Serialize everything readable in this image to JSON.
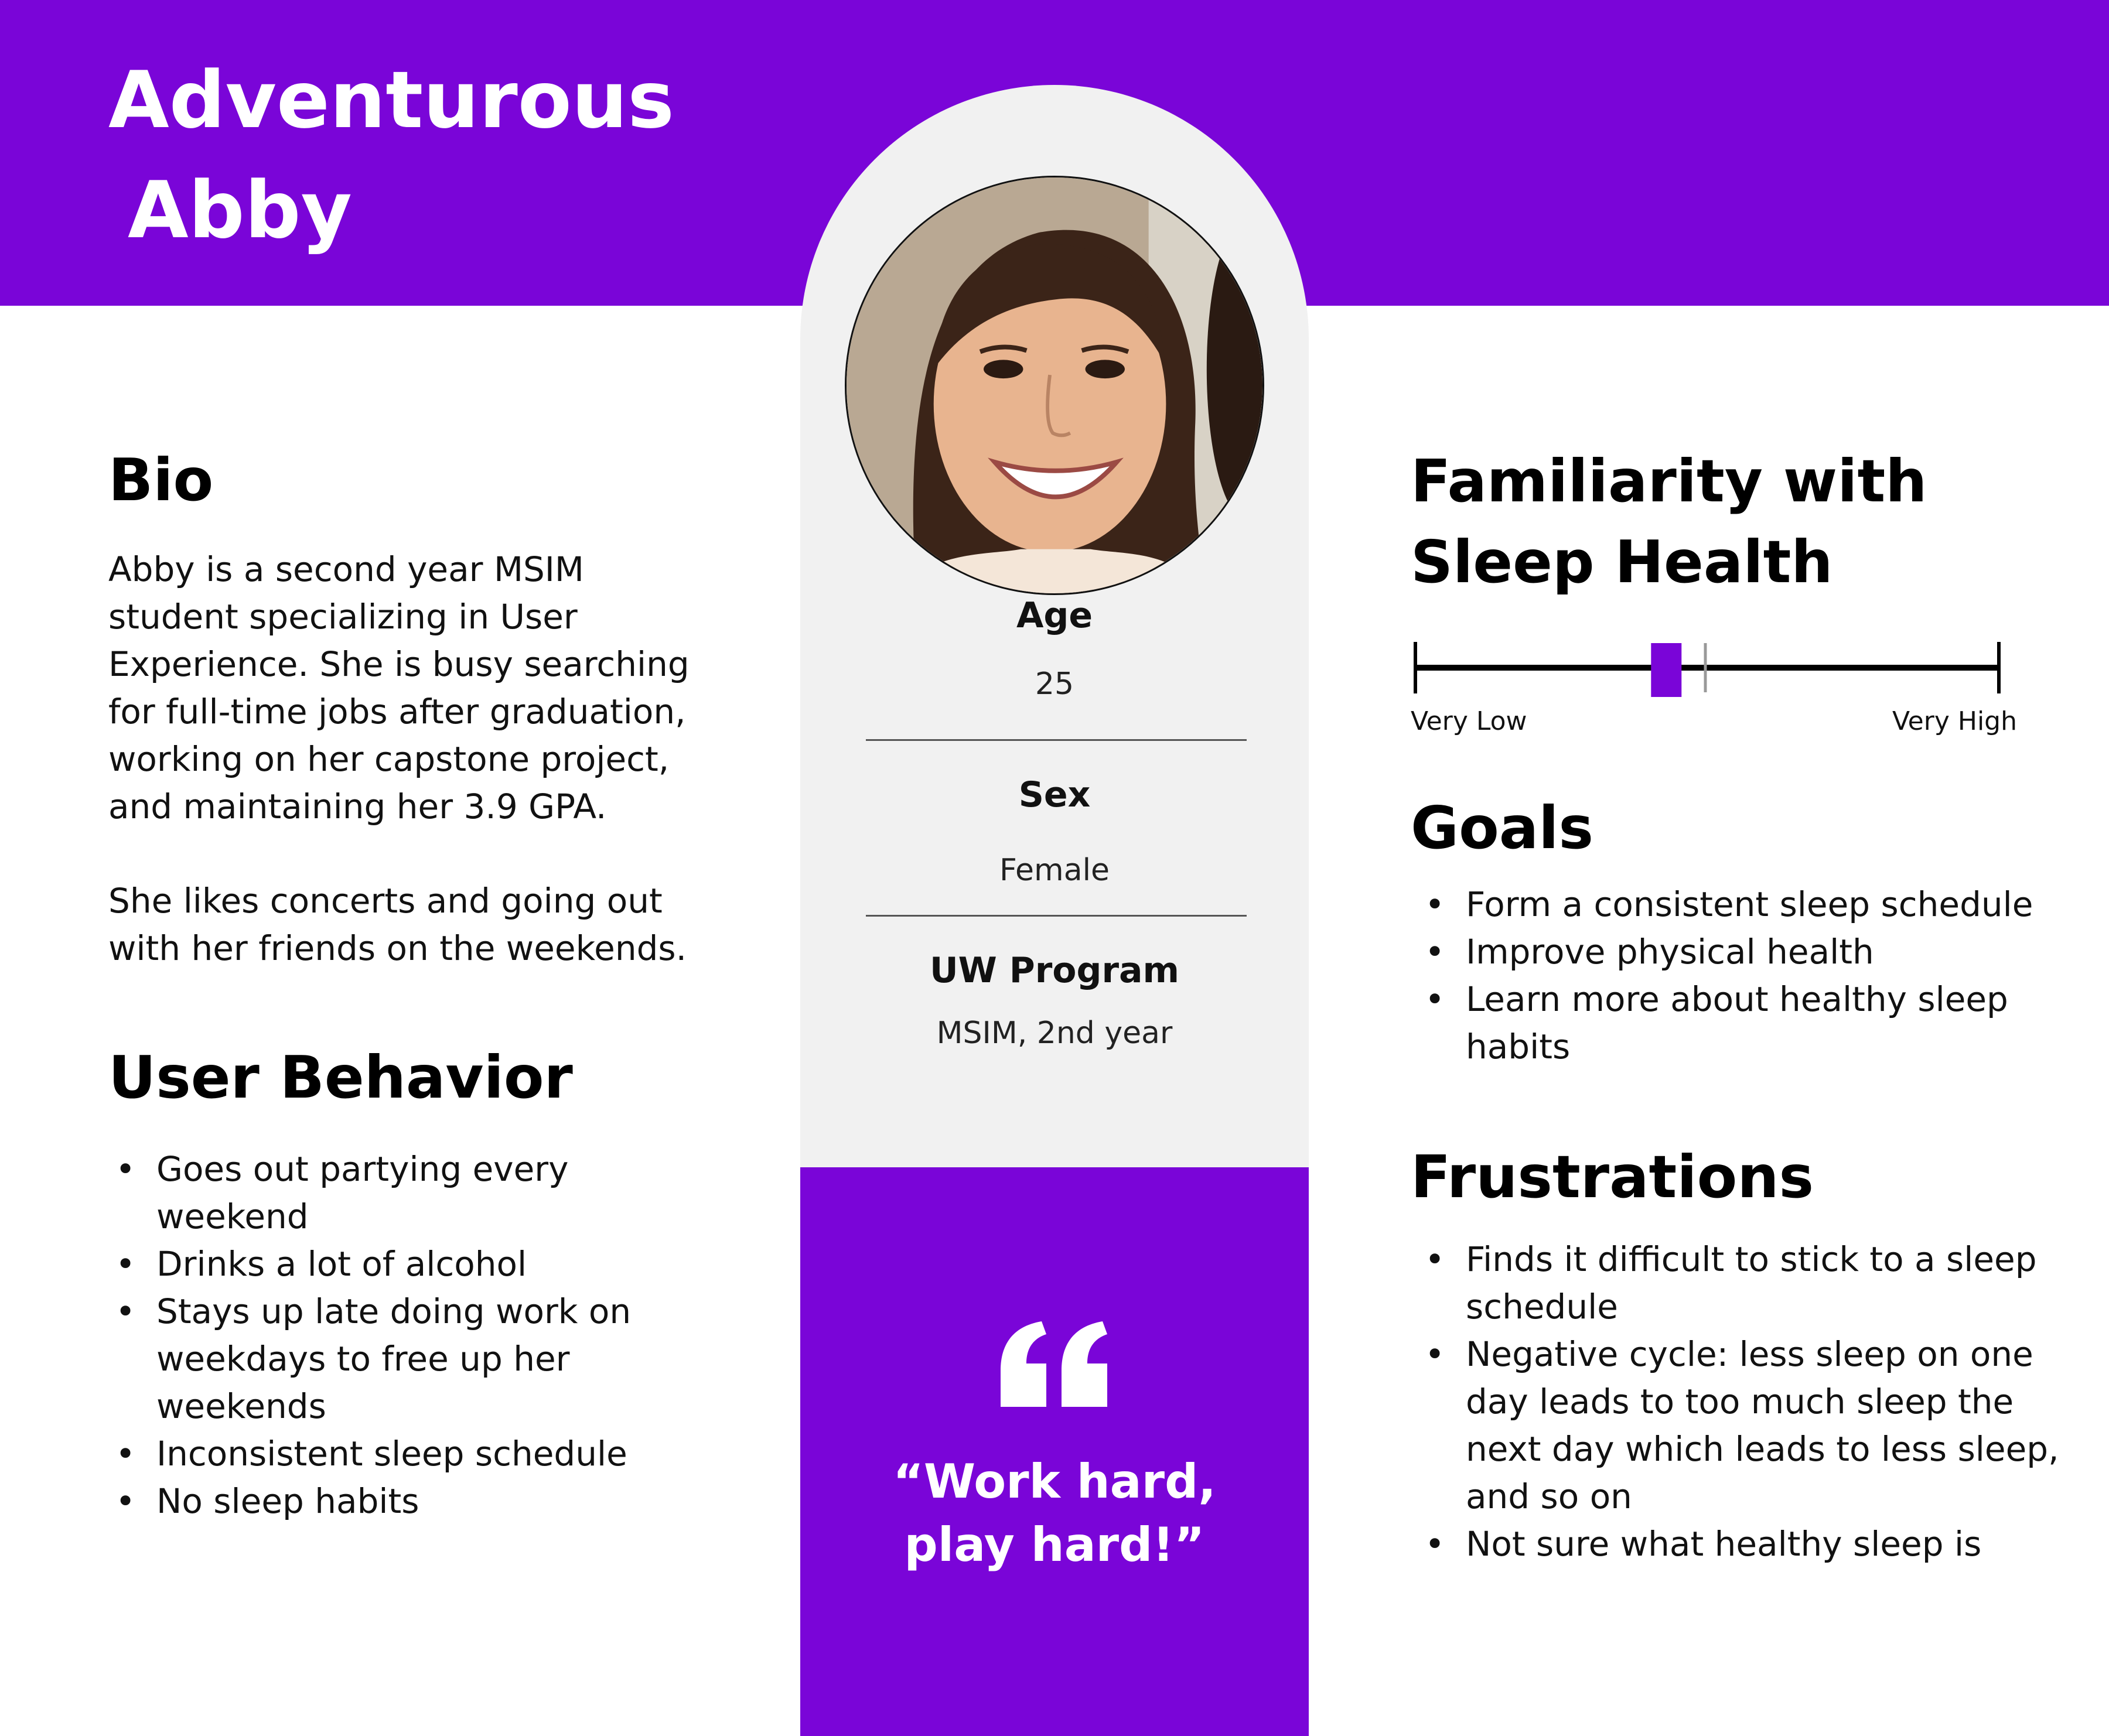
{
  "persona": {
    "name_line_1": "Adventurous",
    "name_line_2": "Abby",
    "photo_icon": "portrait-photo"
  },
  "demographics": {
    "age_label": "Age",
    "age_value": "25",
    "sex_label": "Sex",
    "sex_value": "Female",
    "program_label": "UW Program",
    "program_value": "MSIM, 2nd year"
  },
  "quote": {
    "icon": "quote-icon",
    "text_line_1": "“Work hard,",
    "text_line_2": "play hard!”"
  },
  "bio": {
    "heading": "Bio",
    "paragraph_1": "Abby is a second year MSIM student specializing in User Experience. She is busy searching for full-time jobs after graduation, working on her capstone project, and maintaining her 3.9 GPA.",
    "paragraph_2": "She likes concerts and going out with her friends on the weekends."
  },
  "user_behavior": {
    "heading": "User Behavior",
    "items": [
      "Goes out partying every weekend",
      "Drinks a lot of alcohol",
      "Stays up late doing work on weekdays to free up her weekends",
      "Inconsistent sleep schedule",
      "No sleep habits"
    ]
  },
  "familiarity": {
    "heading_line_1": "Familiarity with",
    "heading_line_2": "Sleep Health",
    "low_label": "Very Low",
    "high_label": "Very High",
    "level": 0.43
  },
  "goals": {
    "heading": "Goals",
    "items": [
      "Form a consistent sleep schedule",
      "Improve physical health",
      "Learn more about healthy sleep habits"
    ]
  },
  "frustrations": {
    "heading": "Frustrations",
    "items": [
      "Finds it difficult to stick to a sleep schedule",
      "Negative cycle: less sleep on one day leads to too much sleep the next day which leads to less sleep, and so on",
      "Not sure what healthy sleep is"
    ]
  },
  "colors": {
    "accent": "#7a05d8",
    "panel": "#f1f1f1"
  }
}
